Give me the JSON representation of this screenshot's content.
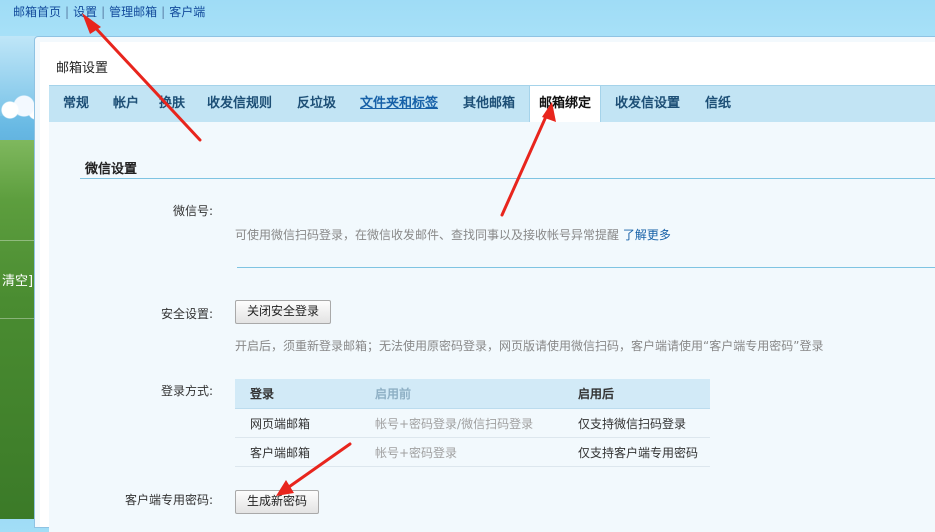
{
  "topnav": {
    "items": [
      "邮箱首页",
      "设置",
      "管理邮箱",
      "客户端"
    ],
    "separator": "|"
  },
  "left_partial_text": "清空]",
  "panel_title": "邮箱设置",
  "tabs": [
    {
      "label": "常规"
    },
    {
      "label": "帐户"
    },
    {
      "label": "换肤"
    },
    {
      "label": "收发信规则"
    },
    {
      "label": "反垃圾"
    },
    {
      "label": "文件夹和标签"
    },
    {
      "label": "其他邮箱"
    },
    {
      "label": "邮箱绑定",
      "active": true
    },
    {
      "label": "收发信设置"
    },
    {
      "label": "信纸"
    }
  ],
  "wechat": {
    "section_title": "微信设置",
    "wechat_id_label": "微信号:",
    "wechat_desc": "可使用微信扫码登录，在微信收发邮件、查找同事以及接收帐号异常提醒",
    "learn_more": "了解更多"
  },
  "security": {
    "label": "安全设置:",
    "button": "关闭安全登录",
    "desc": "开启后，须重新登录邮箱；无法使用原密码登录，网页版请使用微信扫码，客户端请使用“客户端专用密码”登录"
  },
  "login_mode": {
    "label": "登录方式:",
    "headers": [
      "登录",
      "启用前",
      "启用后"
    ],
    "rows": [
      [
        "网页端邮箱",
        "帐号+密码登录/微信扫码登录",
        "仅支持微信扫码登录"
      ],
      [
        "客户端邮箱",
        "帐号+密码登录",
        "仅支持客户端专用密码"
      ]
    ]
  },
  "client_password": {
    "label": "客户端专用密码:",
    "button": "生成新密码"
  },
  "colors": {
    "annotation_arrow": "#e8251d",
    "tab_bar": "#c2e4f4",
    "link": "#1761a8"
  }
}
